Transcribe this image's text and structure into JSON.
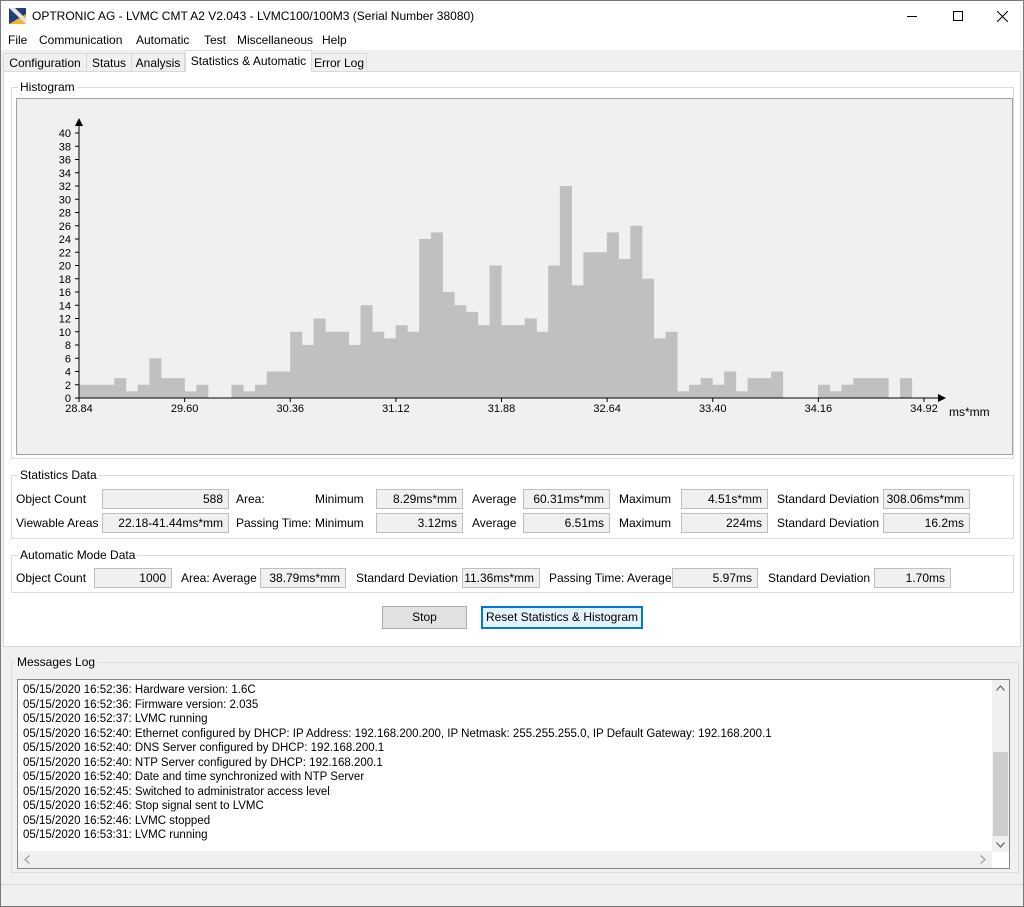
{
  "window": {
    "title": "OPTRONIC AG - LVMC CMT A2 V2.043 - LVMC100/100M3 (Serial Number 38080)"
  },
  "menu": [
    "File",
    "Communication",
    "Automatic",
    "Test",
    "Miscellaneous",
    "Help"
  ],
  "tabs": [
    "Configuration",
    "Status",
    "Analysis",
    "Statistics & Automatic",
    "Error Log"
  ],
  "active_tab": "Statistics & Automatic",
  "histogram": {
    "group_label": "Histogram"
  },
  "chart_data": {
    "type": "bar",
    "title": "",
    "xlabel": "ms*mm",
    "ylabel": "",
    "ylim": [
      0,
      40
    ],
    "y_ticks": [
      0,
      2,
      4,
      6,
      8,
      10,
      12,
      14,
      16,
      18,
      20,
      22,
      24,
      26,
      28,
      30,
      32,
      34,
      36,
      38,
      40
    ],
    "x_ticks": [
      "28.84",
      "29.60",
      "30.36",
      "31.12",
      "31.88",
      "32.64",
      "33.40",
      "34.16",
      "34.92"
    ],
    "xlim": [
      28.84,
      34.92
    ],
    "bin_width": 0.0844,
    "values": [
      2,
      2,
      2,
      3,
      1,
      2,
      6,
      3,
      3,
      1,
      2,
      0,
      0,
      2,
      1,
      2,
      4,
      4,
      10,
      8,
      12,
      10,
      10,
      8,
      14,
      10,
      9,
      11,
      10,
      24,
      25,
      16,
      14,
      13,
      11,
      20,
      11,
      11,
      12,
      10,
      20,
      32,
      17,
      22,
      22,
      25,
      21,
      26,
      18,
      9,
      10,
      1,
      2,
      3,
      2,
      4,
      1,
      3,
      3,
      4,
      0,
      0,
      0,
      2,
      1,
      2,
      3,
      3,
      3,
      0,
      3
    ]
  },
  "stats": {
    "group_label": "Statistics Data",
    "object_count_label": "Object Count",
    "object_count": "588",
    "viewable_label": "Viewable Areas",
    "viewable": "22.18-41.44ms*mm",
    "area_label": "Area:",
    "passing_label": "Passing Time:",
    "minimum_label": "Minimum",
    "average_label": "Average",
    "maximum_label": "Maximum",
    "stddev_label": "Standard Deviation",
    "area_min": "8.29ms*mm",
    "area_avg": "60.31ms*mm",
    "area_max": "4.51s*mm",
    "area_std": "308.06ms*mm",
    "pass_min": "3.12ms",
    "pass_avg": "6.51ms",
    "pass_max": "224ms",
    "pass_std": "16.2ms"
  },
  "auto": {
    "group_label": "Automatic Mode Data",
    "object_count_label": "Object Count",
    "object_count": "1000",
    "area_avg_label": "Area: Average",
    "area_avg": "38.79ms*mm",
    "stddev_label": "Standard Deviation",
    "area_std": "11.36ms*mm",
    "pass_avg_label": "Passing Time: Average",
    "pass_avg": "5.97ms",
    "pass_std": "1.70ms"
  },
  "buttons": {
    "stop": "Stop",
    "reset": "Reset Statistics & Histogram"
  },
  "messages": {
    "label": "Messages Log",
    "lines": [
      "05/15/2020 16:52:36: Hardware version: 1.6C",
      "05/15/2020 16:52:36: Firmware version: 2.035",
      "05/15/2020 16:52:37: LVMC running",
      "05/15/2020 16:52:40: Ethernet configured by DHCP: IP Address: 192.168.200.200, IP Netmask: 255.255.255.0, IP Default Gateway: 192.168.200.1",
      "05/15/2020 16:52:40: DNS Server configured by DHCP: 192.168.200.1",
      "05/15/2020 16:52:40: NTP Server configured by DHCP: 192.168.200.1",
      "05/15/2020 16:52:40: Date and time synchronized with NTP Server",
      "05/15/2020 16:52:45: Switched to administrator access level",
      "05/15/2020 16:52:46: Stop signal sent to LVMC",
      "05/15/2020 16:52:46: LVMC stopped",
      "05/15/2020 16:53:31: LVMC running"
    ]
  },
  "icons": {
    "app": "optronic-logo-icon",
    "minimize": "minimize-icon",
    "maximize": "maximize-icon",
    "close": "close-icon"
  },
  "colors": {
    "bar": "#c0c0c0",
    "plot_bg": "#f0f0f0",
    "focus": "#0078d7"
  }
}
